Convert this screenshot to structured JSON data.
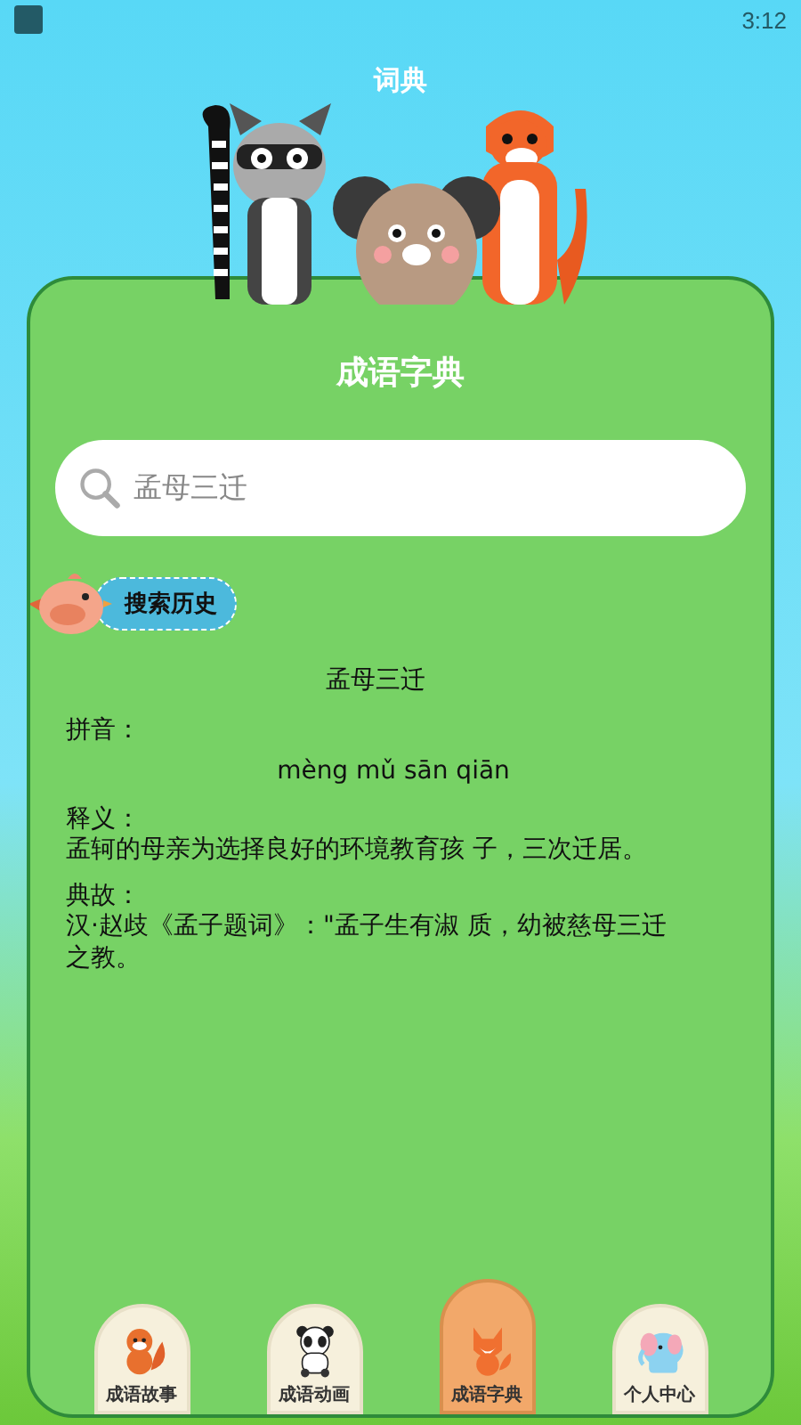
{
  "status_bar": {
    "time": "3:12"
  },
  "header": {
    "title": "词典"
  },
  "card": {
    "title": "成语字典",
    "search": {
      "value": "孟母三迁"
    },
    "history_label": "搜索历史",
    "result": {
      "idiom": "孟母三迁",
      "sections": [
        {
          "label": "拼音：",
          "text": "mèng mǔ sān qiān",
          "kind": "pinyin"
        },
        {
          "label": "释义：",
          "text": "孟轲的母亲为选择良好的环境教育孩 子，三次迁居。",
          "kind": "text"
        },
        {
          "label": "典故：",
          "text": "汉·赵歧《孟子题词》：\"孟子生有淑 质，幼被慈母三迁之教。",
          "kind": "text"
        }
      ]
    }
  },
  "bottom_nav": [
    {
      "label": "成语故事",
      "kind": "squirrel",
      "selected": false
    },
    {
      "label": "成语动画",
      "kind": "panda",
      "selected": false
    },
    {
      "label": "成语字典",
      "kind": "fox",
      "selected": true
    },
    {
      "label": "个人中心",
      "kind": "elephant",
      "selected": false
    }
  ]
}
